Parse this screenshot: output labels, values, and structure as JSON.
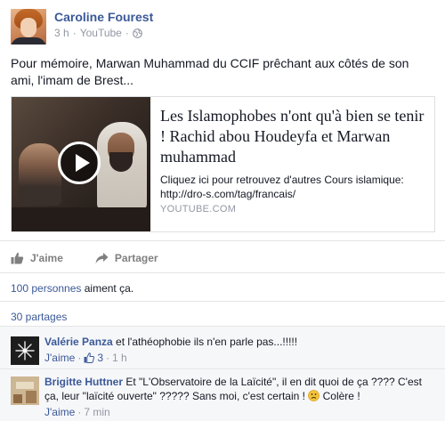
{
  "post": {
    "author": "Caroline Fourest",
    "time": "3 h",
    "separator": "·",
    "source": "YouTube",
    "separator2": "·",
    "text": "Pour mémoire, Marwan Muhammad du CCIF prêchant aux côtés de son ami, l'imam de Brest...",
    "icons": {
      "privacy": "globe-icon",
      "video": "play-icon"
    }
  },
  "link_card": {
    "title": "Les Islamophobes n'ont qu'à bien se tenir ! Rachid abou Houdeyfa et Marwan muhammad",
    "description": "Cliquez ici pour retrouvez d'autres Cours islamique: http://dro-s.com/tag/francais/",
    "domain": "YOUTUBE.COM"
  },
  "actions": {
    "like_label": "J'aime",
    "share_label": "Partager",
    "icons": {
      "like": "thumbs-up-icon",
      "share": "share-arrow-icon"
    }
  },
  "stats": {
    "likes_link": "100 personnes",
    "likes_suffix": " aiment ça.",
    "shares": "30 partages"
  },
  "comments": [
    {
      "name": "Valérie Panza",
      "text": " et l'athéophobie ils n'en parle pas...!!!!!",
      "like_label": "J'aime",
      "sep1": " · ",
      "like_count": "3",
      "sep2": " · ",
      "time": "1 h"
    },
    {
      "name": "Brigitte Huttner",
      "text": " Et \"L'Observatoire de la Laïcité\", il en dit quoi de ça ???? C'est ça, leur \"laïcité ouverte\" ????? Sans moi, c'est certain ! ",
      "text_after": " Colère !",
      "like_label": "J'aime",
      "sep1": " · ",
      "time": "7 min"
    }
  ],
  "colors": {
    "link": "#3b5998",
    "meta": "#9197a3",
    "text": "#141823",
    "comments_bg": "#f6f7f9"
  }
}
